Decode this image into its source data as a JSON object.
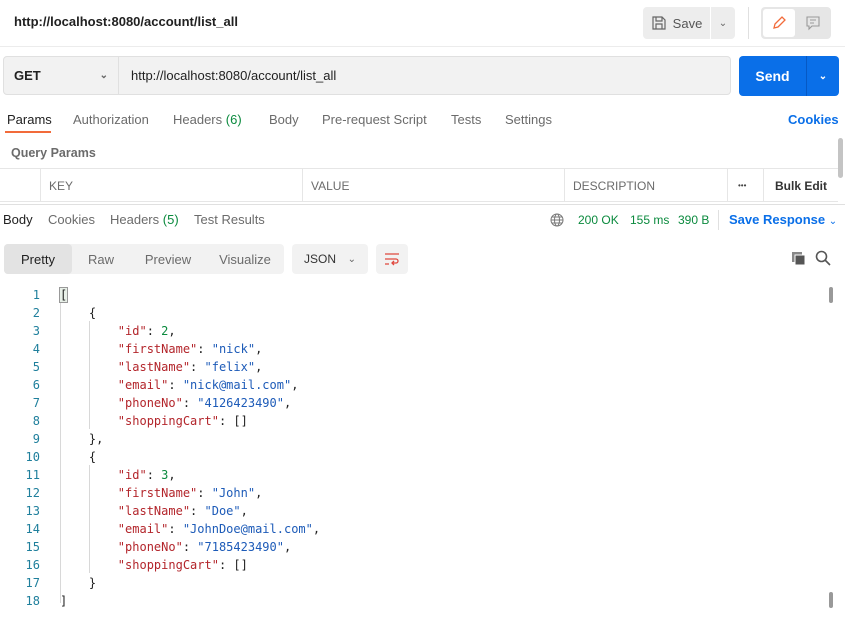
{
  "header": {
    "title": "http://localhost:8080/account/list_all",
    "save_label": "Save"
  },
  "request": {
    "method": "GET",
    "url": "http://localhost:8080/account/list_all",
    "send_label": "Send"
  },
  "request_tabs": [
    {
      "label": "Params"
    },
    {
      "label": "Authorization"
    },
    {
      "label": "Headers",
      "count": "(6)"
    },
    {
      "label": "Body"
    },
    {
      "label": "Pre-request Script"
    },
    {
      "label": "Tests"
    },
    {
      "label": "Settings"
    }
  ],
  "cookies_label": "Cookies",
  "query_params": {
    "title": "Query Params",
    "columns": [
      "KEY",
      "VALUE",
      "DESCRIPTION"
    ],
    "more": "•••",
    "bulk_edit": "Bulk Edit"
  },
  "response_tabs": [
    {
      "label": "Body"
    },
    {
      "label": "Cookies"
    },
    {
      "label": "Headers",
      "count": "(5)"
    },
    {
      "label": "Test Results"
    }
  ],
  "response_status": {
    "status": "200 OK",
    "time": "155 ms",
    "size": "390 B",
    "save_response": "Save Response"
  },
  "view_modes": [
    "Pretty",
    "Raw",
    "Preview",
    "Visualize"
  ],
  "format": "JSON",
  "colors": {
    "accent": "#0a6fe8",
    "success": "#0b8a3e",
    "key": "#b3252b",
    "string": "#1d5bb8",
    "edit": "#f26b3a"
  },
  "code_lines": [
    [
      [
        "p",
        "["
      ]
    ],
    [
      [
        "p",
        "    {"
      ]
    ],
    [
      [
        "p",
        "        "
      ],
      [
        "k",
        "\"id\""
      ],
      [
        "p",
        ": "
      ],
      [
        "n",
        "2"
      ],
      [
        "p",
        ","
      ]
    ],
    [
      [
        "p",
        "        "
      ],
      [
        "k",
        "\"firstName\""
      ],
      [
        "p",
        ": "
      ],
      [
        "s",
        "\"nick\""
      ],
      [
        "p",
        ","
      ]
    ],
    [
      [
        "p",
        "        "
      ],
      [
        "k",
        "\"lastName\""
      ],
      [
        "p",
        ": "
      ],
      [
        "s",
        "\"felix\""
      ],
      [
        "p",
        ","
      ]
    ],
    [
      [
        "p",
        "        "
      ],
      [
        "k",
        "\"email\""
      ],
      [
        "p",
        ": "
      ],
      [
        "s",
        "\"nick@mail.com\""
      ],
      [
        "p",
        ","
      ]
    ],
    [
      [
        "p",
        "        "
      ],
      [
        "k",
        "\"phoneNo\""
      ],
      [
        "p",
        ": "
      ],
      [
        "s",
        "\"4126423490\""
      ],
      [
        "p",
        ","
      ]
    ],
    [
      [
        "p",
        "        "
      ],
      [
        "k",
        "\"shoppingCart\""
      ],
      [
        "p",
        ": []"
      ]
    ],
    [
      [
        "p",
        "    },"
      ]
    ],
    [
      [
        "p",
        "    {"
      ]
    ],
    [
      [
        "p",
        "        "
      ],
      [
        "k",
        "\"id\""
      ],
      [
        "p",
        ": "
      ],
      [
        "n",
        "3"
      ],
      [
        "p",
        ","
      ]
    ],
    [
      [
        "p",
        "        "
      ],
      [
        "k",
        "\"firstName\""
      ],
      [
        "p",
        ": "
      ],
      [
        "s",
        "\"John\""
      ],
      [
        "p",
        ","
      ]
    ],
    [
      [
        "p",
        "        "
      ],
      [
        "k",
        "\"lastName\""
      ],
      [
        "p",
        ": "
      ],
      [
        "s",
        "\"Doe\""
      ],
      [
        "p",
        ","
      ]
    ],
    [
      [
        "p",
        "        "
      ],
      [
        "k",
        "\"email\""
      ],
      [
        "p",
        ": "
      ],
      [
        "s",
        "\"JohnDoe@mail.com\""
      ],
      [
        "p",
        ","
      ]
    ],
    [
      [
        "p",
        "        "
      ],
      [
        "k",
        "\"phoneNo\""
      ],
      [
        "p",
        ": "
      ],
      [
        "s",
        "\"7185423490\""
      ],
      [
        "p",
        ","
      ]
    ],
    [
      [
        "p",
        "        "
      ],
      [
        "k",
        "\"shoppingCart\""
      ],
      [
        "p",
        ": []"
      ]
    ],
    [
      [
        "p",
        "    }"
      ]
    ],
    [
      [
        "p",
        "]"
      ]
    ]
  ]
}
